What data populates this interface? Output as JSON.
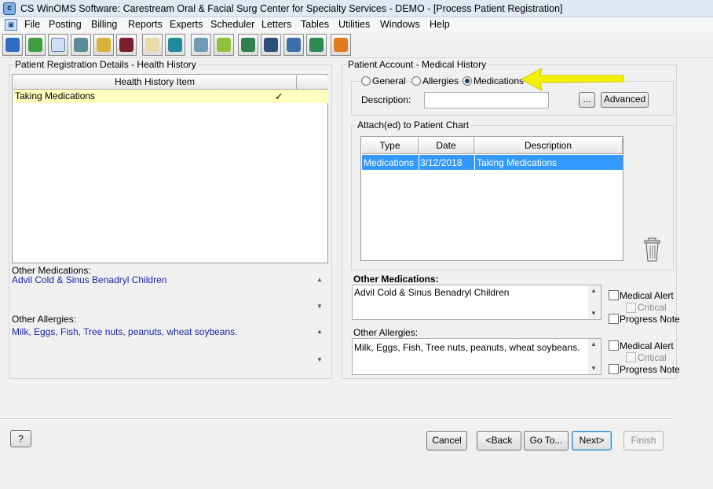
{
  "window": {
    "title": "CS WinOMS Software:  Carestream Oral & Facial Surg Center for Specialty Services - DEMO - [Process Patient Registration]"
  },
  "menu": [
    "File",
    "Posting",
    "Billing",
    "Reports",
    "Experts",
    "Scheduler",
    "Letters",
    "Tables",
    "Utilities",
    "Windows",
    "Help"
  ],
  "toolbar": {
    "icons": [
      "patient-info-icon",
      "network-icon",
      "search-icon",
      "scanner-icon",
      "gold-folder-icon",
      "medical-cross-icon",
      "notepad-icon",
      "door-exit-icon",
      "document-print-icon",
      "green-calendar-icon",
      "green-book-icon",
      "windows-icon",
      "ledger-icon",
      "checkbook-icon",
      "logout-icon"
    ]
  },
  "left": {
    "group_label": "Patient Registration Details - Health History",
    "table_header": "Health History Item",
    "rows": [
      {
        "item": "Taking Medications",
        "check": "✓"
      }
    ],
    "other_medications_label": "Other Medications:",
    "other_medications_value": "Advil Cold & Sinus  Benadryl Children",
    "other_allergies_label": "Other Allergies:",
    "other_allergies_value": "Milk, Eggs, Fish, Tree nuts, peanuts, wheat soybeans."
  },
  "right": {
    "group_label": "Patient Account - Medical History",
    "radios": [
      {
        "label": "General",
        "selected": false
      },
      {
        "label": "Allergies",
        "selected": false
      },
      {
        "label": "Medications",
        "selected": true
      }
    ],
    "description_label": "Description:",
    "description_value": "",
    "ellipsis_label": "...",
    "advanced_label": "Advanced",
    "attached_label": "Attach(ed) to Patient Chart",
    "columns": [
      "Type",
      "Date",
      "Description"
    ],
    "rows": [
      {
        "type": "Medications",
        "date": "3/12/2018",
        "description": "Taking Medications"
      }
    ],
    "other_medications_label": "Other Medications:",
    "other_medications_value": "Advil Cold & Sinus  Benadryl Children",
    "other_allergies_label": "Other Allergies:",
    "other_allergies_value": "Milk, Eggs, Fish, Tree nuts, peanuts, wheat soybeans.",
    "medical_alert_label": "Medical Alert",
    "critical_label": "Critical",
    "progress_note_label": "Progress Note"
  },
  "footer": {
    "help_label": "?",
    "cancel_label": "Cancel",
    "back_label": "<Back",
    "goto_label": "Go To...",
    "next_label": "Next>",
    "finish_label": "Finish"
  },
  "colors": {
    "highlight_row": "#ffffc0",
    "selection": "#3399ff",
    "arrow": "#f2f200",
    "data_text": "#1a26a8"
  }
}
